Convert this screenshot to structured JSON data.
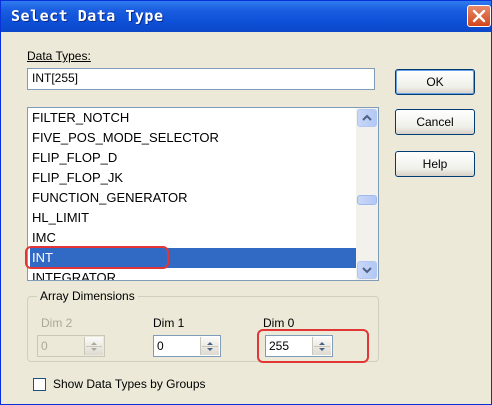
{
  "window": {
    "title": "Select Data Type"
  },
  "data_types": {
    "label": "Data Types:",
    "value": "INT[255]"
  },
  "buttons": {
    "ok": "OK",
    "cancel": "Cancel",
    "help": "Help"
  },
  "type_list": {
    "items": [
      "FILTER_NOTCH",
      "FIVE_POS_MODE_SELECTOR",
      "FLIP_FLOP_D",
      "FLIP_FLOP_JK",
      "FUNCTION_GENERATOR",
      "HL_LIMIT",
      "IMC",
      "INT",
      "INTEGRATOR"
    ],
    "selected": "INT"
  },
  "array_dimensions": {
    "title": "Array Dimensions",
    "dim2": {
      "label": "Dim 2",
      "value": "0"
    },
    "dim1": {
      "label": "Dim 1",
      "value": "0"
    },
    "dim0": {
      "label": "Dim 0",
      "value": "255"
    }
  },
  "show_groups": {
    "label": "Show Data Types by Groups",
    "checked": false
  },
  "colors": {
    "title_bar": "#0D4FD6",
    "selection": "#316AC5",
    "highlight": "#E23636",
    "dialog_bg": "#ECE9D8"
  },
  "icons": {
    "close": "close-icon",
    "scroll_up": "scroll-up-icon",
    "scroll_down": "scroll-down-icon",
    "spin": "spin-arrows-icon"
  }
}
